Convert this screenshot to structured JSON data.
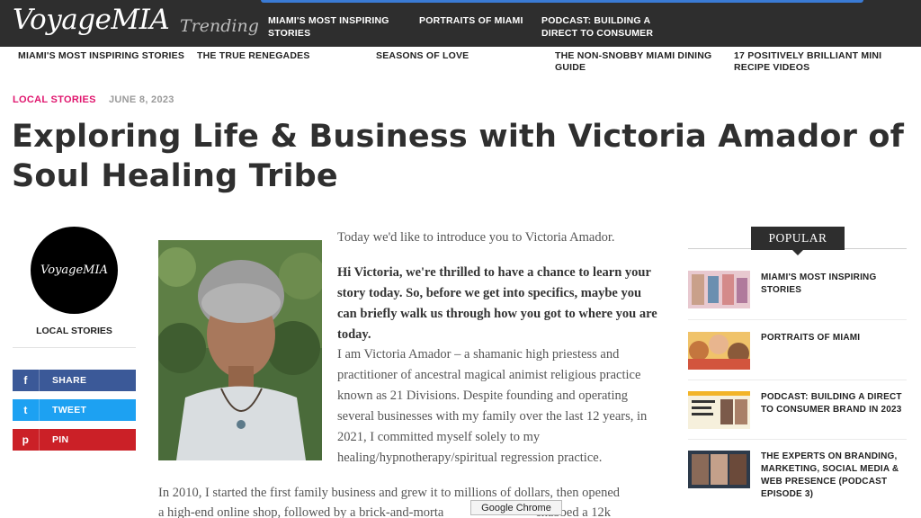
{
  "header": {
    "logo": "VoyageMIA",
    "trending_label": "Trending",
    "trending_links": [
      "MIAMI'S MOST INSPIRING STORIES",
      "PORTRAITS OF MIAMI",
      "PODCAST: BUILDING A DIRECT TO CONSUMER"
    ]
  },
  "subnav": [
    "MIAMI'S MOST INSPIRING STORIES",
    "THE TRUE RENEGADES",
    "SEASONS OF LOVE",
    "THE NON-SNOBBY MIAMI DINING GUIDE",
    "17 POSITIVELY BRILLIANT MINI RECIPE VIDEOS"
  ],
  "article": {
    "category": "LOCAL STORIES",
    "date": "JUNE 8, 2023",
    "title": "Exploring Life & Business with Victoria Amador of Soul Healing Tribe",
    "intro": "Today we'd like to introduce you to Victoria Amador.",
    "question": "Hi Victoria, we're thrilled to have a chance to learn your story today. So, before we get into specifics, maybe you can briefly walk us through how you got to where you are today.",
    "answer": "I am Victoria Amador – a shamanic high priestess and practitioner of ancestral magical animist religious practice known as 21 Divisions. Despite founding and operating several businesses with my family over the last 12 years, in 2021, I committed myself solely to my healing/hypnotherapy/spiritual regression practice.",
    "para2_line1": "In 2010, I started the first family business and grew it to millions of dollars, then opened",
    "para2_line2": "a high-end online shop, followed by a brick-and-morta",
    "para2_line2_end": "ehabbed a 12k"
  },
  "left_column": {
    "avatar_text": "VoyageMIA",
    "category": "LOCAL STORIES",
    "share": [
      {
        "label": "SHARE",
        "icon": "facebook-icon",
        "glyph": "f",
        "color": "#3b5998"
      },
      {
        "label": "TWEET",
        "icon": "twitter-icon",
        "glyph": "t",
        "color": "#1da1f2"
      },
      {
        "label": "PIN",
        "icon": "pinterest-icon",
        "glyph": "p",
        "color": "#cb2027"
      }
    ]
  },
  "sidebar": {
    "heading": "POPULAR",
    "items": [
      {
        "title": "MIAMI'S MOST INSPIRING STORIES"
      },
      {
        "title": "PORTRAITS OF MIAMI"
      },
      {
        "title": "PODCAST: BUILDING A DIRECT TO CONSUMER BRAND IN 2023"
      },
      {
        "title": "THE EXPERTS ON BRANDING, MARKETING, SOCIAL MEDIA & WEB PRESENCE (PODCAST EPISODE 3)"
      }
    ]
  },
  "tooltip": "Google Chrome",
  "colors": {
    "accent": "#e0166e",
    "header_bg": "#2e2e2e"
  }
}
